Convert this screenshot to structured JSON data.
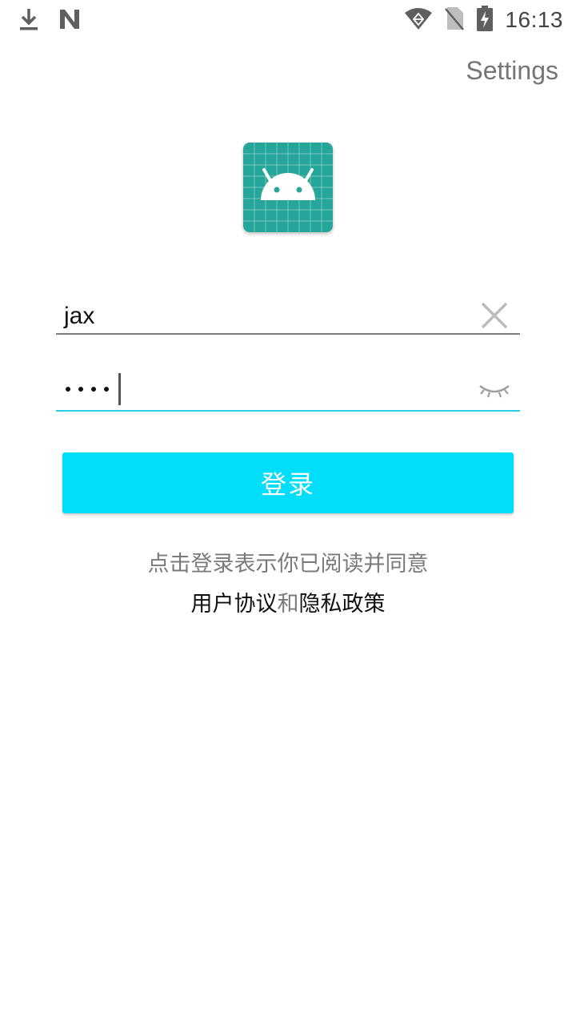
{
  "status_bar": {
    "time": "16:13",
    "left_icons": [
      "download-icon",
      "n-notification-icon"
    ],
    "right_icons": [
      "wifi-icon",
      "no-sim-icon",
      "battery-charging-icon"
    ]
  },
  "toolbar": {
    "settings_label": "Settings"
  },
  "app_icon": {
    "name": "android-app-icon",
    "background_color": "#26a69a"
  },
  "login_form": {
    "username_value": "jax",
    "password_masked": "••••",
    "password_length": 4,
    "clear_icon": "close-icon",
    "visibility_icon": "eye-closed-icon"
  },
  "login_button": {
    "label": "登录",
    "color": "#00def9"
  },
  "agreement": {
    "prefix": "点击登录表示你已阅读并同意",
    "user_agreement": "用户协议",
    "conjunction": "和",
    "privacy_policy": "隐私政策"
  }
}
